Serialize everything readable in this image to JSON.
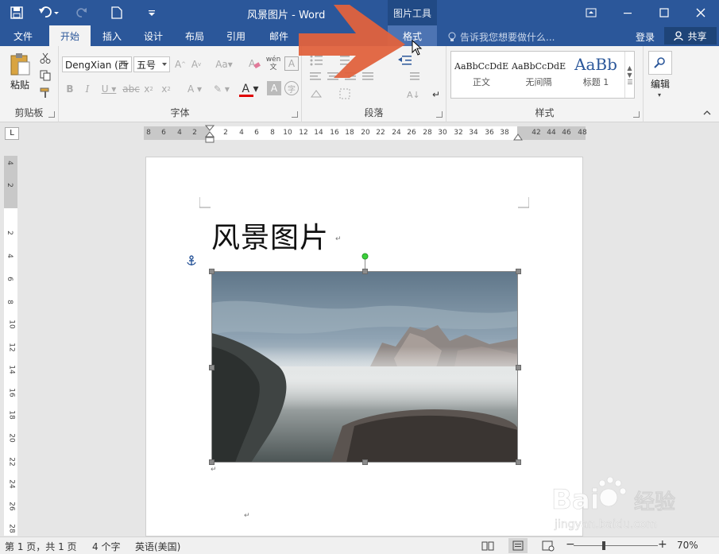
{
  "window": {
    "title": "风景图片 - Word",
    "context_tool_title": "图片工具"
  },
  "quick_access": [
    "save-icon",
    "undo-icon",
    "redo-icon",
    "new-document-icon",
    "customize-qat-icon"
  ],
  "tabs": [
    {
      "label": "文件"
    },
    {
      "label": "开始",
      "active": true
    },
    {
      "label": "插入"
    },
    {
      "label": "设计"
    },
    {
      "label": "布局"
    },
    {
      "label": "引用"
    },
    {
      "label": "邮件"
    },
    {
      "label": "格式",
      "contextual": true
    }
  ],
  "tell_me": "告诉我您想要做什么...",
  "sign_in": "登录",
  "share": "共享",
  "ribbon": {
    "clipboard": {
      "label": "剪贴板",
      "paste": "粘贴"
    },
    "font": {
      "label": "字体",
      "font_name": "DengXian (西",
      "font_size": "五号",
      "change_case": "Aa",
      "phonetic": "wén"
    },
    "paragraph": {
      "label": "段落"
    },
    "styles": {
      "label": "样式",
      "items": [
        {
          "sample": "AaBbCcDdE",
          "name": "正文"
        },
        {
          "sample": "AaBbCcDdE",
          "name": "无间隔"
        },
        {
          "sample": "AaBb",
          "name": "标题 1"
        }
      ]
    },
    "editing": {
      "label": "编辑"
    }
  },
  "ruler": {
    "horizontal": [
      "8",
      "6",
      "4",
      "2",
      "2",
      "4",
      "6",
      "8",
      "10",
      "12",
      "14",
      "16",
      "18",
      "20",
      "22",
      "24",
      "26",
      "28",
      "30",
      "32",
      "34",
      "36",
      "38",
      "42",
      "44",
      "46",
      "48"
    ],
    "vertical": [
      "4",
      "2",
      "2",
      "4",
      "6",
      "8",
      "10",
      "12",
      "14",
      "16",
      "18",
      "20",
      "22",
      "24",
      "26",
      "28"
    ]
  },
  "document": {
    "title": "风景图片",
    "paragraph_mark": "↵"
  },
  "status": {
    "page": "第 1 页，共 1 页",
    "words": "4 个字",
    "language": "英语(美国)",
    "zoom": "70%"
  },
  "colors": {
    "word_blue": "#2b579a",
    "arrow": "#e0623d",
    "font_color": "#e00000"
  }
}
